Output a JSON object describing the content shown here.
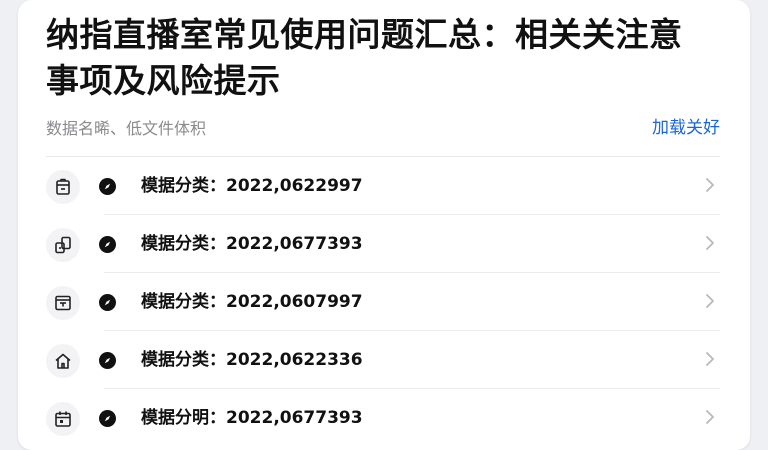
{
  "header": {
    "title": "纳指直播室常见使用问题汇总：相关关注意事项及风险提示",
    "subtitle": "数据名晞、低文件体积",
    "action_link": "加载关好"
  },
  "items": [
    {
      "icon": "bag-icon",
      "label": "模据分类：2022,0622997"
    },
    {
      "icon": "phone-transfer-icon",
      "label": "模据分类：2022,0677393"
    },
    {
      "icon": "monitor-icon",
      "label": "模据分类：2022,0607997"
    },
    {
      "icon": "home-icon",
      "label": "模据分类：2022,0622336"
    },
    {
      "icon": "calendar-icon",
      "label": "模据分明：2022,0677393"
    }
  ],
  "colors": {
    "accent": "#1a66d6",
    "text": "#111111",
    "muted": "#8a8a8f",
    "background": "#eef0f3"
  }
}
